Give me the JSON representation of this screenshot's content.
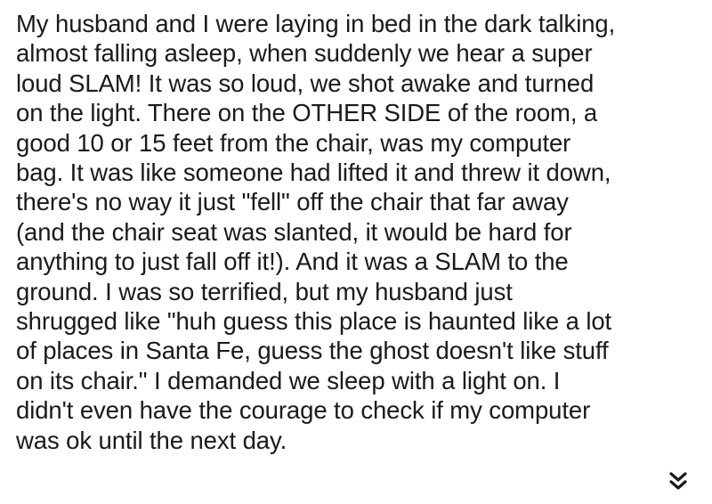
{
  "post": {
    "lines": [
      "My husband and I were laying in bed in the dark talking,",
      "almost falling asleep, when suddenly we hear a super",
      "loud SLAM! It was so loud, we shot awake and turned",
      "on the light. There on the OTHER SIDE of the room, a",
      "good 10 or 15 feet from the chair, was my computer",
      "bag. It was like someone had lifted it and threw it down,",
      "there's no way it just \"fell\" off the chair that far away",
      "(and the chair seat was slanted, it would be hard for",
      "anything to just fall off it!). And it was a SLAM to the",
      "ground. I was so terrified, but my husband just",
      "shrugged like \"huh guess this place is haunted like a lot",
      "of places in Santa Fe, guess the ghost doesn't like stuff",
      "on its chair.\" I demanded we sleep with a light on. I",
      "didn't even have the courage to check if my computer",
      "was ok until the next day."
    ]
  },
  "controls": {
    "expand_icon": "double-chevron-down-icon"
  }
}
